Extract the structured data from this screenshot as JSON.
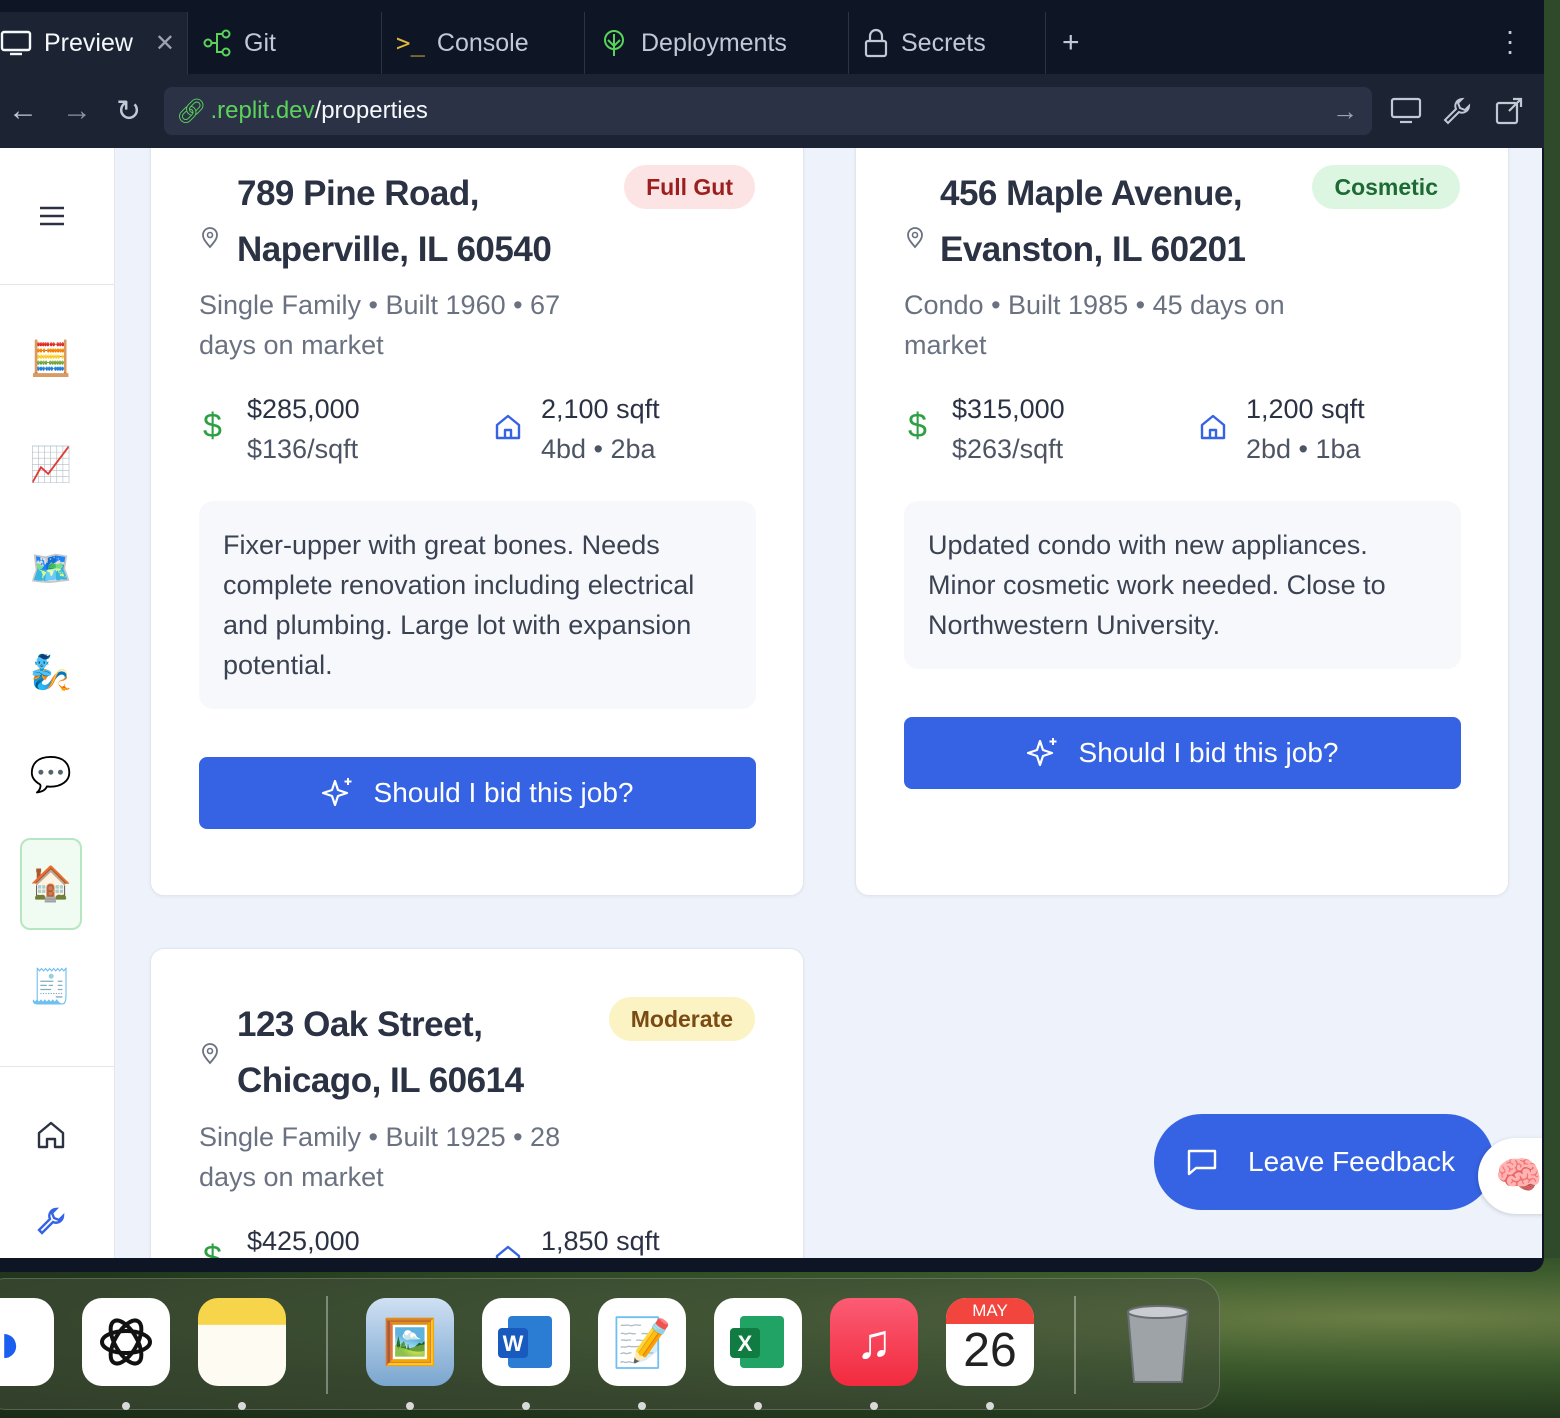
{
  "tabs": [
    {
      "label": "Preview",
      "icon": "monitor-icon"
    },
    {
      "label": "Git",
      "icon": "git-icon"
    },
    {
      "label": "Console",
      "icon": "terminal-icon"
    },
    {
      "label": "Deployments",
      "icon": "deployments-icon"
    },
    {
      "label": "Secrets",
      "icon": "lock-icon"
    }
  ],
  "url": {
    "domain": ".replit.dev",
    "path": "/properties"
  },
  "sidebar": {
    "items": [
      {
        "name": "abacus",
        "glyph": "🧮"
      },
      {
        "name": "chart",
        "glyph": "📈"
      },
      {
        "name": "map",
        "glyph": "🗺️"
      },
      {
        "name": "person",
        "glyph": "🧞"
      },
      {
        "name": "chat",
        "glyph": "💬"
      },
      {
        "name": "house",
        "glyph": "🏠"
      },
      {
        "name": "receipt",
        "glyph": "🧾"
      }
    ]
  },
  "properties": [
    {
      "address_line1": "789 Pine Road,",
      "address_line2": "Naperville, IL 60540",
      "badge": "Full Gut",
      "meta": "Single Family • Built 1960 • 67 days on market",
      "price": "$285,000",
      "price_per_sqft": "$136/sqft",
      "sqft": "2,100 sqft",
      "beds_baths": "4bd • 2ba",
      "description": "Fixer-upper with great bones. Needs complete renovation including electrical and plumbing. Large lot with expansion potential.",
      "button": "Should I bid this job?"
    },
    {
      "address_line1": "456 Maple Avenue,",
      "address_line2": "Evanston, IL 60201",
      "badge": "Cosmetic",
      "meta": "Condo • Built 1985 • 45 days on market",
      "price": "$315,000",
      "price_per_sqft": "$263/sqft",
      "sqft": "1,200 sqft",
      "beds_baths": "2bd • 1ba",
      "description": "Updated condo with new appliances. Minor cosmetic work needed. Close to Northwestern University.",
      "button": "Should I bid this job?"
    },
    {
      "address_line1": "123 Oak Street,",
      "address_line2": "Chicago, IL 60614",
      "badge": "Moderate",
      "meta": "Single Family • Built 1925 • 28 days on market",
      "price": "$425,000",
      "sqft": "1,850 sqft"
    }
  ],
  "feedback_button": "Leave Feedback",
  "dock": {
    "calendar_month": "MAY",
    "calendar_day": "26",
    "apps": [
      "Safari",
      "ChatGPT",
      "Notes",
      "Preview",
      "Word",
      "TextEdit",
      "Excel",
      "Music",
      "Calendar",
      "Trash"
    ]
  }
}
